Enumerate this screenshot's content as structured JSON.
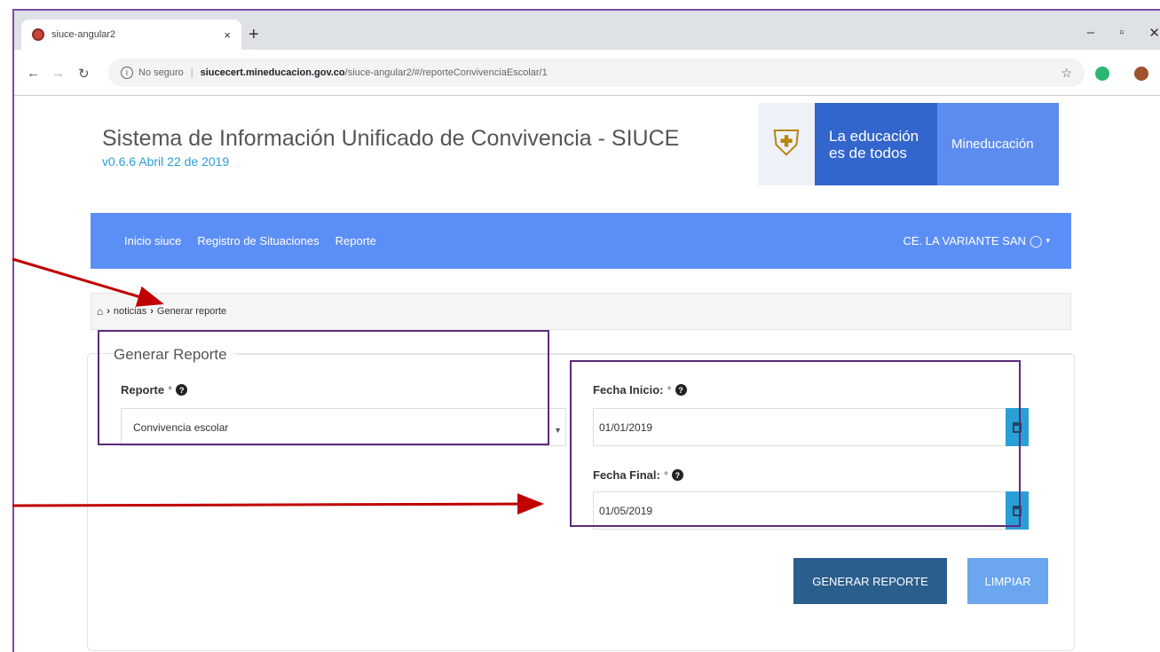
{
  "browser": {
    "tab_title": "siuce-angular2",
    "tab_close": "×",
    "new_tab": "+",
    "window_controls": [
      "–",
      "▫",
      "✕"
    ],
    "security_label": "No seguro",
    "url_host": "siucecert.mineducacion.gov.co",
    "url_path": "/siuce-angular2/#/reporteConvivenciaEscolar/1"
  },
  "header": {
    "title": "Sistema de Información Unificado de Convivencia - SIUCE",
    "version": "v0.6.6 Abril 22 de 2019",
    "slogan_line1": "La educación",
    "slogan_line2": "es de todos",
    "ministry": "Mineducación"
  },
  "nav": {
    "items": [
      "Inicio siuce",
      "Registro de Situaciones",
      "Reporte"
    ],
    "user": "CE. LA VARIANTE SAN"
  },
  "breadcrumb": {
    "home_icon": "home-icon",
    "items": [
      "noticias",
      "Generar reporte"
    ]
  },
  "form": {
    "legend": "Generar Reporte",
    "reporte_label": "Reporte",
    "reporte_value": "Convivencia escolar",
    "fecha_inicio_label": "Fecha Inicio:",
    "fecha_inicio_value": "01/01/2019",
    "fecha_final_label": "Fecha Final:",
    "fecha_final_value": "01/05/2019",
    "required_mark": "*",
    "generate_button": "GENERAR REPORTE",
    "clear_button": "LIMPIAR"
  },
  "colors": {
    "navbar": "#5c8ff5",
    "primary_button": "#2a5e8c",
    "secondary_button": "#6ba6ee",
    "annotation_box": "#5e2b7a",
    "annotation_arrow": "#c00000"
  }
}
